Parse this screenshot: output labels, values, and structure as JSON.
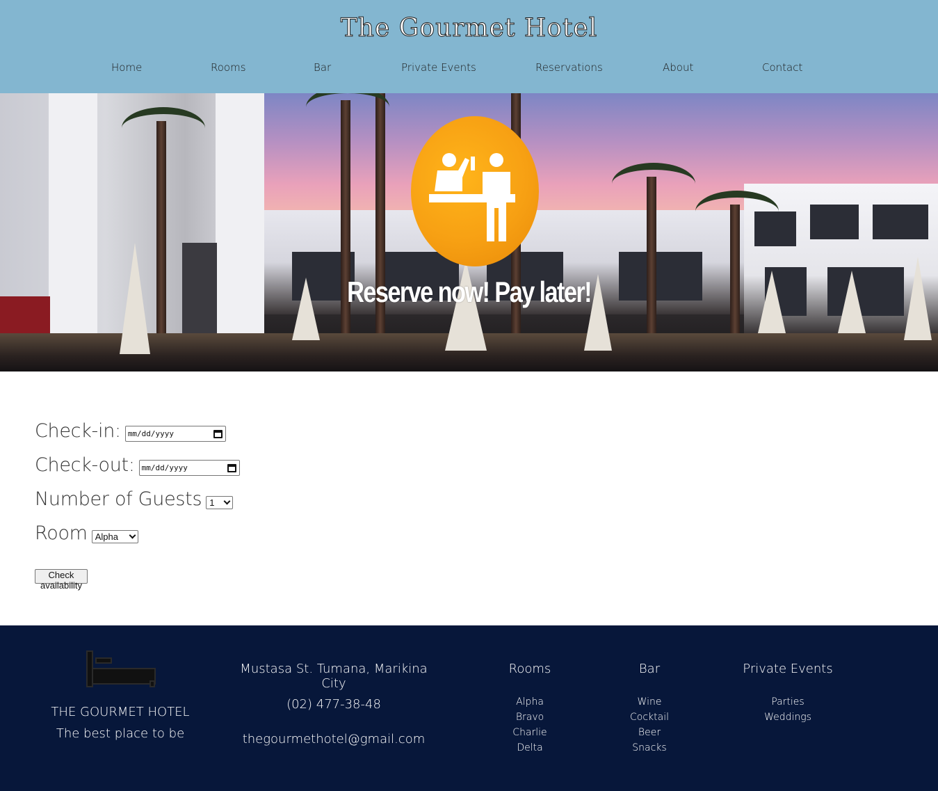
{
  "site": {
    "title": "The Gourmet Hotel"
  },
  "nav": {
    "items": [
      {
        "label": "Home"
      },
      {
        "label": "Rooms"
      },
      {
        "label": "Bar"
      },
      {
        "label": "Private Events"
      },
      {
        "label": "Reservations"
      },
      {
        "label": "About"
      },
      {
        "label": "Contact"
      }
    ]
  },
  "hero": {
    "headline": "Reserve now! Pay later!",
    "badge_icon": "reception-desk-icon",
    "badge_color": "#f7a013"
  },
  "form": {
    "checkin_label": "Check-in:",
    "checkin_placeholder": "mm/dd/yyyy",
    "checkout_label": "Check-out:",
    "checkout_placeholder": "mm/dd/yyyy",
    "guests_label": "Number of Guests",
    "guests_value": "1",
    "room_label": "Room",
    "room_value": "Alpha",
    "submit_label": "Check availability"
  },
  "footer": {
    "icon": "bed-icon",
    "brand": "THE GOURMET HOTEL",
    "tagline": "The best place to be",
    "address": "Mustasa St. Tumana, Marikina City",
    "phone": "(02) 477-38-48",
    "email": "thegourmethotel@gmail.com",
    "rooms": {
      "title": "Rooms",
      "items": [
        "Alpha",
        "Bravo",
        "Charlie",
        "Delta"
      ]
    },
    "bar": {
      "title": "Bar",
      "items": [
        "Wine",
        "Cocktail",
        "Beer",
        "Snacks"
      ]
    },
    "events": {
      "title": "Private Events",
      "items": [
        "Parties",
        "Weddings"
      ]
    }
  },
  "colors": {
    "header_bg": "#83b6d0",
    "footer_bg": "#07173a"
  }
}
